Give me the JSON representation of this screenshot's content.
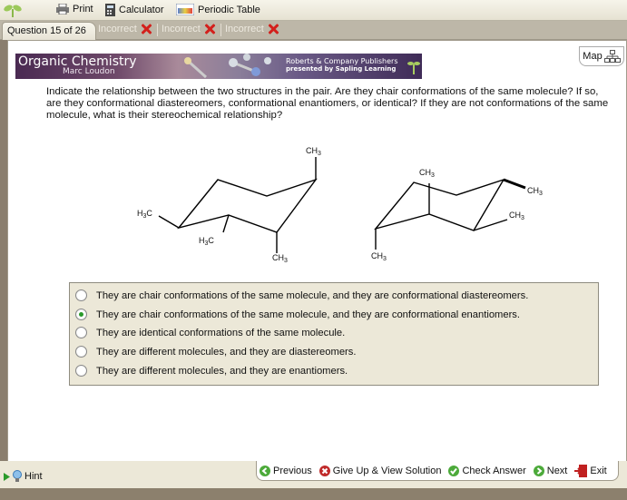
{
  "toolbar": {
    "print_label": "Print",
    "calculator_label": "Calculator",
    "periodic_table_label": "Periodic Table"
  },
  "tabs": {
    "question_label": "Question 15 of 26",
    "attempts": [
      {
        "label": "Incorrect"
      },
      {
        "label": "Incorrect"
      },
      {
        "label": "Incorrect"
      }
    ]
  },
  "banner": {
    "title": "Organic Chemistry",
    "author": "Marc Loudon",
    "publisher": "Roberts & Company Publishers",
    "presented_by": "presented by Sapling Learning"
  },
  "map_label": "Map",
  "question": {
    "text": "Indicate the relationship between the two structures in the pair. Are they chair conformations of the same molecule? If so, are they conformational diastereomers, conformational enantiomers, or identical? If they are not conformations of the same molecule, what is their stereochemical relationship?"
  },
  "structures": {
    "left": {
      "labels": [
        "CH3",
        "H3C",
        "H3C",
        "CH3"
      ]
    },
    "right": {
      "labels": [
        "CH3",
        "CH3",
        "CH3",
        "CH3"
      ]
    }
  },
  "choices": [
    {
      "label": "They are chair conformations of the same molecule, and they are conformational diastereomers.",
      "selected": false
    },
    {
      "label": "They are chair conformations of the same molecule, and they are conformational enantiomers.",
      "selected": true
    },
    {
      "label": "They are identical conformations of the same molecule.",
      "selected": false
    },
    {
      "label": "They are different molecules, and they are diastereomers.",
      "selected": false
    },
    {
      "label": "They are different molecules, and they are enantiomers.",
      "selected": false
    }
  ],
  "bottom": {
    "hint_label": "Hint",
    "previous_label": "Previous",
    "give_up_label": "Give Up & View Solution",
    "check_label": "Check Answer",
    "next_label": "Next",
    "exit_label": "Exit"
  }
}
